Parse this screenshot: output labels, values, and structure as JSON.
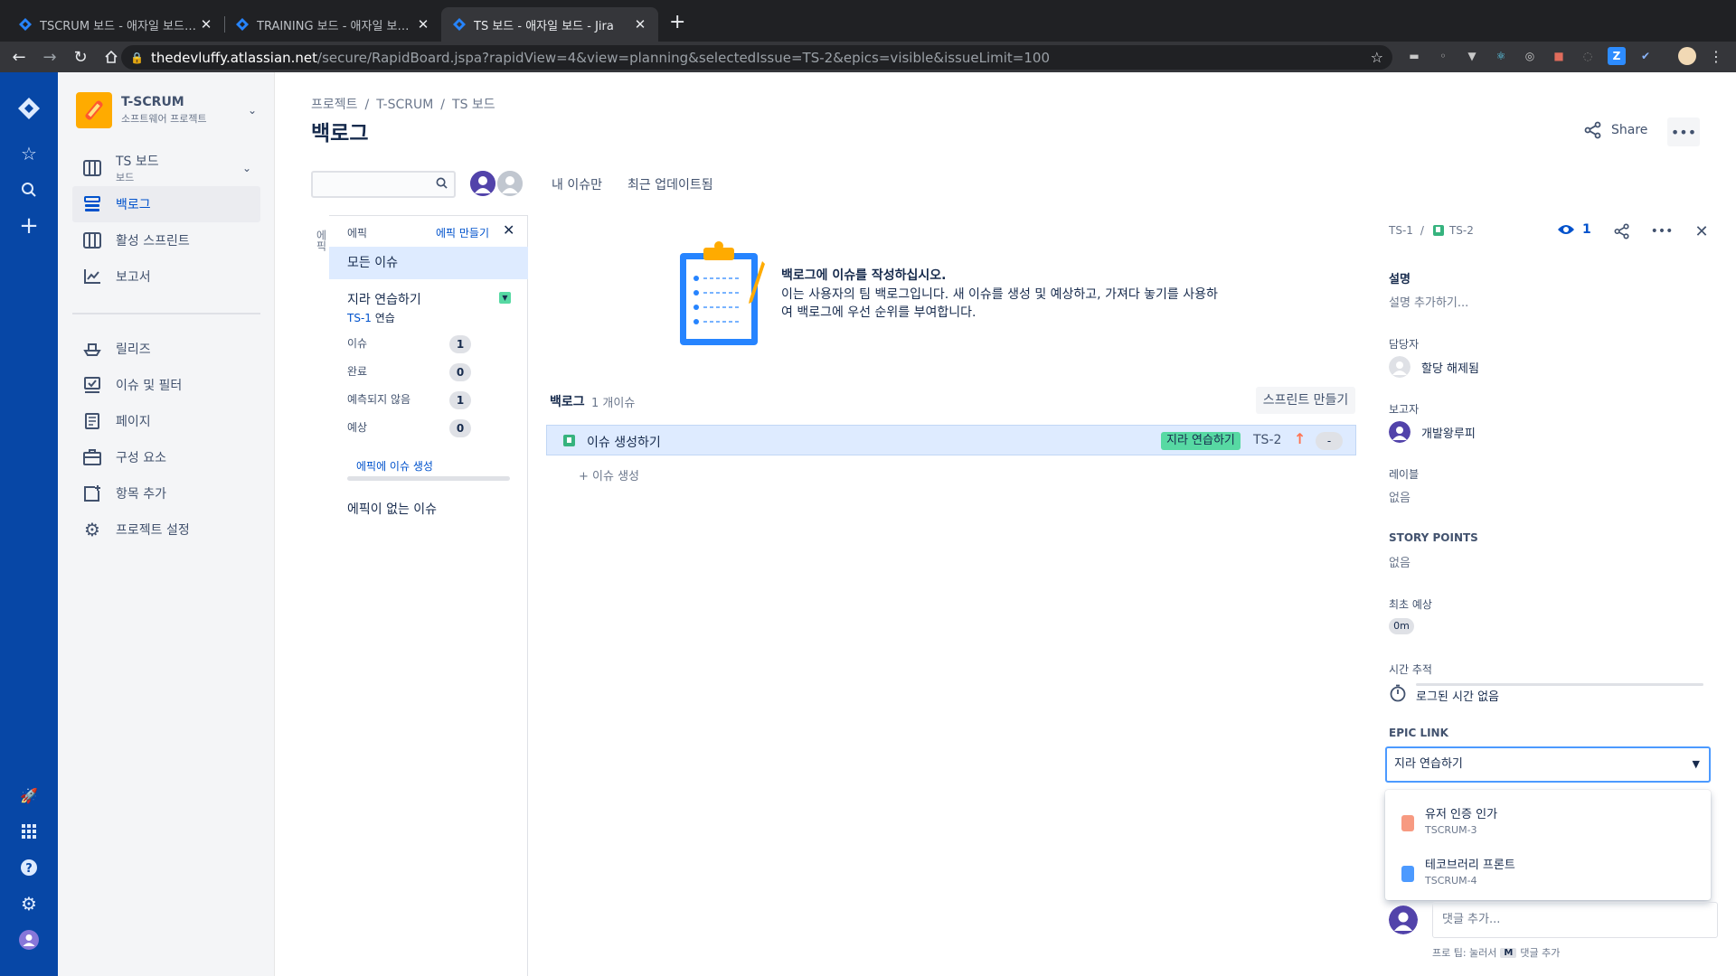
{
  "browser": {
    "tabs": [
      {
        "title": "TSCRUM 보드 - 애자일 보드 - Jira"
      },
      {
        "title": "TRAINING 보드 - 애자일 보드 - Jira"
      },
      {
        "title": "TS 보드 - 애자일 보드 - Jira"
      }
    ],
    "url_host": "thedevluffy.atlassian.net",
    "url_path": "/secure/RapidBoard.jspa?rapidView=4&view=planning&selectedIssue=TS-2&epics=visible&issueLimit=100"
  },
  "sidebar": {
    "project_name": "T-SCRUM",
    "project_type": "소프트웨어 프로젝트",
    "board_name": "TS 보드",
    "board_sub": "보드",
    "items_top": [
      "백로그",
      "활성 스프린트",
      "보고서"
    ],
    "items_bottom": [
      "릴리즈",
      "이슈 및 필터",
      "페이지",
      "구성 요소",
      "항목 추가",
      "프로젝트 설정"
    ]
  },
  "main": {
    "breadcrumb": [
      "프로젝트",
      "T-SCRUM",
      "TS 보드"
    ],
    "title": "백로그",
    "share": "Share",
    "quick_filters": [
      "내 이슈만",
      "최근 업데이트됨"
    ],
    "epic_tab": "에픽"
  },
  "epic_panel": {
    "header": "에픽",
    "create": "에픽 만들기",
    "all_issues": "모든 이슈",
    "epic_name": "지라 연습하기",
    "epic_key": "TS-1",
    "epic_key_suffix": "연습",
    "stats": [
      {
        "label": "이슈",
        "count": "1"
      },
      {
        "label": "완료",
        "count": "0"
      },
      {
        "label": "예측되지 않음",
        "count": "1"
      },
      {
        "label": "예상",
        "count": "0"
      }
    ],
    "add_issue": "에픽에 이슈 생성",
    "no_epic": "에픽이 없는 이슈"
  },
  "empty_state": {
    "title": "백로그에 이슈를 작성하십시오.",
    "description": "이는 사용자의 팀 백로그입니다. 새 이슈를 생성 및 예상하고, 가져다 놓기를 사용하여 백로그에 우선 순위를 부여합니다."
  },
  "backlog": {
    "title": "백로그",
    "count": "1 개이슈",
    "create_sprint": "스프린트 만들기",
    "issue": {
      "summary": "이슈 생성하기",
      "epic": "지라 연습하기",
      "key": "TS-2",
      "estimate": "-"
    },
    "create_issue": "+ 이슈 생성"
  },
  "detail": {
    "parent_key": "TS-1",
    "sep": "/",
    "key": "TS-2",
    "watchers": "1",
    "description_label": "설명",
    "description_placeholder": "설명 추가하기...",
    "assignee_label": "담당자",
    "assignee": "할당 해제됨",
    "reporter_label": "보고자",
    "reporter": "개발왕루피",
    "labels_label": "레이블",
    "labels_value": "없음",
    "sp_label": "STORY POINTS",
    "sp_value": "없음",
    "orig_est_label": "최초 예상",
    "orig_est": "0m",
    "time_label": "시간 추적",
    "time_value": "로그된 시간 없음",
    "epic_link_label": "EPIC LINK",
    "epic_link_value": "지라 연습하기",
    "epic_options": [
      {
        "name": "유저 인증 인가",
        "key": "TSCRUM-3",
        "color": "#f79a81"
      },
      {
        "name": "테코브러리 프론트",
        "key": "TSCRUM-4",
        "color": "#4c9aff"
      }
    ],
    "comment_placeholder": "댓글 추가...",
    "protip_prefix": "프로 팁: 눌러서",
    "protip_key": "M",
    "protip_suffix": "댓글 추가"
  }
}
